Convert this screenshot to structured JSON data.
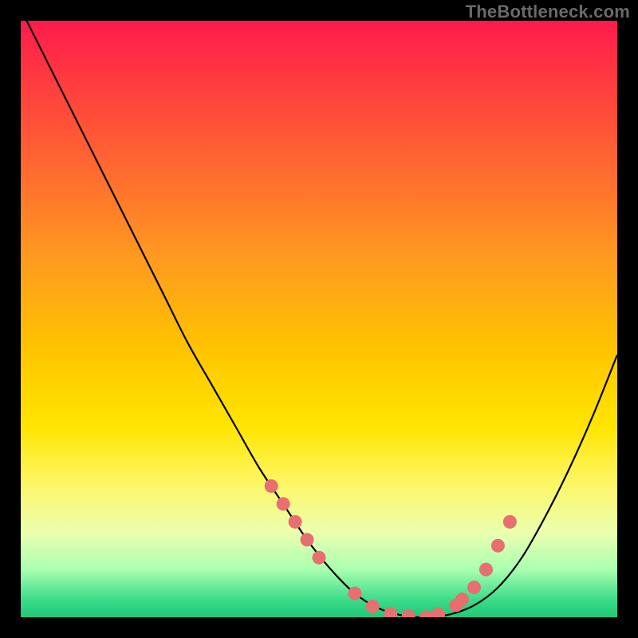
{
  "watermark": "TheBottleneck.com",
  "colors": {
    "frame": "#000000",
    "curve_stroke": "#000000",
    "marker_fill": "#e76f6f"
  },
  "chart_data": {
    "type": "line",
    "title": "",
    "xlabel": "",
    "ylabel": "",
    "xlim": [
      0,
      100
    ],
    "ylim": [
      0,
      100
    ],
    "series": [
      {
        "name": "bottleneck-curve",
        "x": [
          0,
          4,
          8,
          12,
          16,
          20,
          24,
          28,
          32,
          36,
          40,
          44,
          48,
          52,
          56,
          60,
          64,
          68,
          72,
          76,
          80,
          84,
          88,
          92,
          96,
          100
        ],
        "y": [
          102,
          94,
          86,
          78,
          70,
          62,
          54,
          46,
          39,
          32,
          25,
          19,
          13,
          8,
          4,
          1.5,
          0.3,
          0,
          0.5,
          2,
          5,
          10,
          17,
          25,
          34,
          44
        ]
      }
    ],
    "markers": {
      "name": "highlight-dots",
      "x": [
        42,
        44,
        46,
        48,
        50,
        56,
        59,
        62,
        65,
        68,
        70,
        73,
        74,
        76,
        78,
        80,
        82
      ],
      "y": [
        22,
        19,
        16,
        13,
        10,
        4,
        1.8,
        0.6,
        0.2,
        0,
        0.5,
        2,
        3,
        5,
        8,
        12,
        16
      ]
    }
  }
}
